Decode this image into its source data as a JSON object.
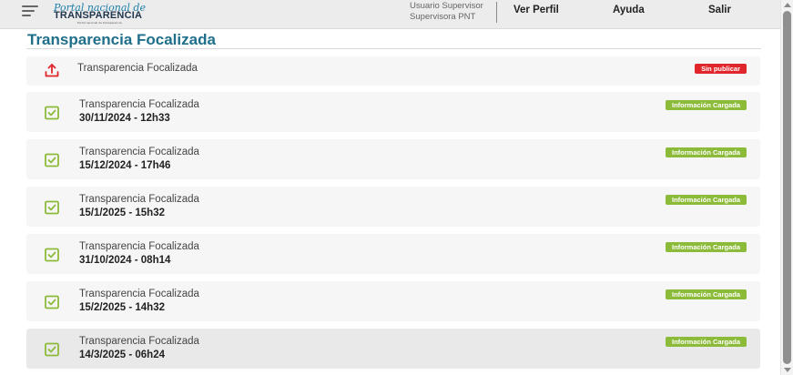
{
  "header": {
    "logo_script": "Portal nacional de",
    "logo_main": "TRANSPARENCIA",
    "logo_sub": "Portal nacional de transparencia",
    "user_name": "Usuario Supervisor",
    "user_role": "Supervisora PNT",
    "nav": [
      "Ver Perfil",
      "Ayuda",
      "Salir"
    ]
  },
  "page": {
    "title": "Transparencia Focalizada"
  },
  "colors": {
    "accent": "#1f6f8b",
    "badge_loaded": "#8cbb3a",
    "badge_unpublished": "#e0262a",
    "icon_green": "#8cbb3a",
    "icon_red": "#e0262a"
  },
  "unpublished": {
    "title": "Transparencia Focalizada",
    "status": "Sin publicar",
    "icon": "upload-icon"
  },
  "records": [
    {
      "title": "Transparencia Focalizada",
      "date": "30/11/2024 - 12h33",
      "status": "Información Cargada",
      "icon": "document-check-icon"
    },
    {
      "title": "Transparencia Focalizada",
      "date": "15/12/2024 - 17h46",
      "status": "Información Cargada",
      "icon": "document-check-icon"
    },
    {
      "title": "Transparencia Focalizada",
      "date": "15/1/2025 - 15h32",
      "status": "Información Cargada",
      "icon": "document-check-icon"
    },
    {
      "title": "Transparencia Focalizada",
      "date": "31/10/2024 - 08h14",
      "status": "Información Cargada",
      "icon": "document-check-icon"
    },
    {
      "title": "Transparencia Focalizada",
      "date": "15/2/2025 - 14h32",
      "status": "Información Cargada",
      "icon": "document-check-icon"
    },
    {
      "title": "Transparencia Focalizada",
      "date": "14/3/2025 - 06h24",
      "status": "Información Cargada",
      "icon": "document-check-icon"
    }
  ]
}
